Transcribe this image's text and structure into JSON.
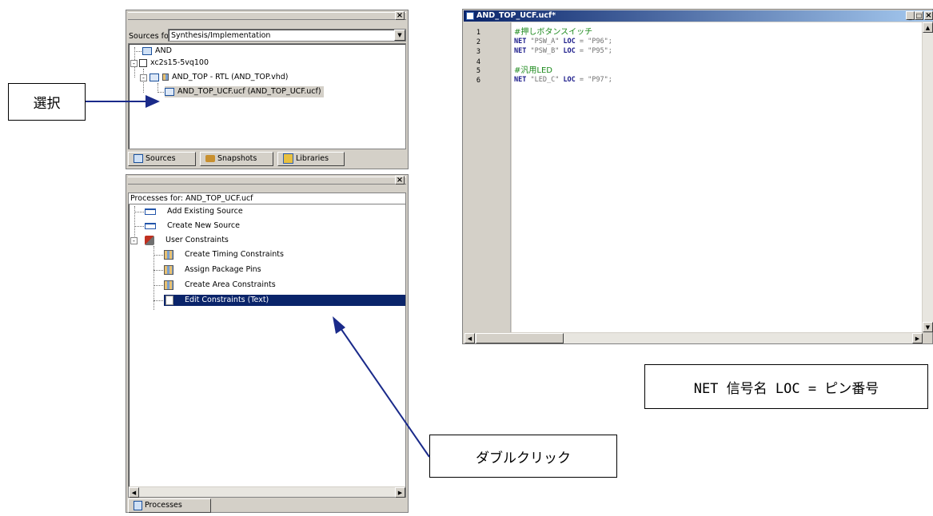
{
  "sources_panel": {
    "sources_for_label": "Sources for:",
    "sources_for_value": "Synthesis/Implementation",
    "tree": [
      "AND",
      "xc2s15-5vq100",
      "AND_TOP - RTL (AND_TOP.vhd)",
      "AND_TOP_UCF.ucf (AND_TOP_UCF.ucf)"
    ],
    "tabs": [
      "Sources",
      "Snapshots",
      "Libraries"
    ]
  },
  "processes_panel": {
    "header": "Processes for: AND_TOP_UCF.ucf",
    "items": [
      "Add Existing Source",
      "Create New Source",
      "User Constraints",
      "Create Timing Constraints",
      "Assign Package Pins",
      "Create Area Constraints",
      "Edit Constraints (Text)"
    ],
    "tab": "Processes"
  },
  "editor": {
    "title": "AND_TOP_UCF.ucf*",
    "line_numbers": [
      "1",
      "2",
      "3",
      "4",
      "5",
      "6"
    ],
    "lines": [
      {
        "comment": "#押しボタンスイッチ"
      },
      {
        "kw1": "NET",
        "sig": "\"PSW_A\"",
        "kw2": "LOC",
        "val": "= \"P96\";"
      },
      {
        "kw1": "NET",
        "sig": "\"PSW_B\"",
        "kw2": "LOC",
        "val": "= \"P95\";"
      },
      {},
      {
        "comment": "#汎用LED"
      },
      {
        "kw1": "NET",
        "sig": "\"LED_C\"",
        "kw2": "LOC",
        "val": "= \"P97\";"
      }
    ]
  },
  "callouts": {
    "select": "選択",
    "double_click": "ダブルクリック",
    "syntax": "NET 信号名 LOC = ピン番号"
  },
  "colors": {
    "selection": "#0a246a",
    "arrow": "#1a2a8a",
    "titlebar_start": "#0a246a",
    "titlebar_end": "#a6caf0"
  }
}
